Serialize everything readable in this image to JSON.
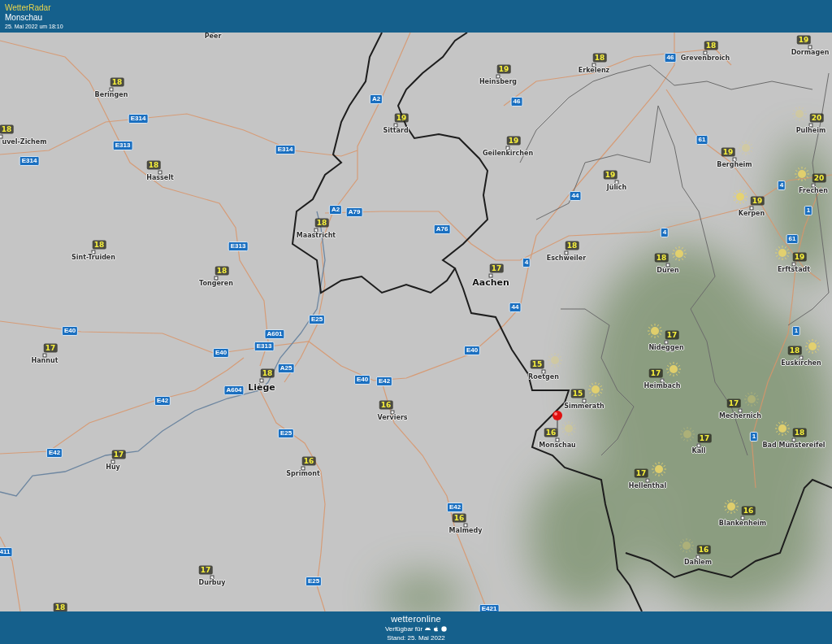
{
  "header": {
    "title": "WetterRadar",
    "location": "Monschau",
    "timestamp": "25. Mai 2022 um 18:10"
  },
  "map": {
    "cities": [
      {
        "name": "Peer"
      },
      {
        "name": "Beringen",
        "temp": "18"
      },
      {
        "name": "uvel-Zichem",
        "temp": "18"
      },
      {
        "name": "Hasselt",
        "temp": "18"
      },
      {
        "name": "Sint-Truiden",
        "temp": "18"
      },
      {
        "name": "Tongeren",
        "temp": "18"
      },
      {
        "name": "Maastricht",
        "temp": "18"
      },
      {
        "name": "Sittard",
        "temp": "19"
      },
      {
        "name": "Heinsberg",
        "temp": "19"
      },
      {
        "name": "Erkelenz",
        "temp": "18"
      },
      {
        "name": "Grevenbroich",
        "temp": "18"
      },
      {
        "name": "Dormagen",
        "temp": "19"
      },
      {
        "name": "Geilenkirchen",
        "temp": "19"
      },
      {
        "name": "Jülich",
        "temp": "19"
      },
      {
        "name": "Pulheim",
        "temp": "20",
        "sun": true,
        "hazy": true
      },
      {
        "name": "Bergheim",
        "temp": "19",
        "sun": true,
        "hazy": true
      },
      {
        "name": "Frechen",
        "temp": "20",
        "sun": true,
        "hazy": false
      },
      {
        "name": "Kerpen",
        "temp": "19",
        "sun": true,
        "hazy": false
      },
      {
        "name": "Eschweiler",
        "temp": "18"
      },
      {
        "name": "Aachen",
        "temp": "17",
        "major": true
      },
      {
        "name": "Düren",
        "temp": "18",
        "sun": true,
        "hazy": false
      },
      {
        "name": "Erftstadt",
        "temp": "19",
        "sun": true,
        "hazy": false
      },
      {
        "name": "Liège",
        "temp": "18",
        "major": true
      },
      {
        "name": "Hannut",
        "temp": "17"
      },
      {
        "name": "Huy",
        "temp": "17"
      },
      {
        "name": "Verviers",
        "temp": "16"
      },
      {
        "name": "Sprimont",
        "temp": "16"
      },
      {
        "name": "Durbuy",
        "temp": "17"
      },
      {
        "temp": "18"
      },
      {
        "name": "Malmedy",
        "temp": "16"
      },
      {
        "name": "Roetgen",
        "temp": "15",
        "sun": true,
        "hazy": true
      },
      {
        "name": "Simmerath",
        "temp": "15",
        "sun": true,
        "hazy": false
      },
      {
        "name": "Monschau",
        "temp": "16",
        "sun": true,
        "hazy": true,
        "pinned": true
      },
      {
        "name": "Nideggen",
        "temp": "17",
        "sun": true,
        "hazy": false
      },
      {
        "name": "Heimbach",
        "temp": "17",
        "sun": true,
        "hazy": false
      },
      {
        "name": "Euskirchen",
        "temp": "18",
        "sun": true,
        "hazy": false
      },
      {
        "name": "Mechernich",
        "temp": "17",
        "sun": true,
        "hazy": true
      },
      {
        "name": "Kall",
        "temp": "17",
        "sun": true,
        "hazy": true
      },
      {
        "name": "Bad Münstereifel",
        "temp": "18",
        "sun": true,
        "hazy": false
      },
      {
        "name": "Hellenthal",
        "temp": "17",
        "sun": true,
        "hazy": false
      },
      {
        "name": "Blankenheim",
        "temp": "16",
        "sun": true,
        "hazy": false
      },
      {
        "name": "Dahlem",
        "temp": "16",
        "sun": true,
        "hazy": true
      }
    ],
    "road_shields": [
      {
        "label": "E314"
      },
      {
        "label": "E313"
      },
      {
        "label": "E314"
      },
      {
        "label": "E314"
      },
      {
        "label": "A2"
      },
      {
        "label": "A2"
      },
      {
        "label": "A79"
      },
      {
        "label": "E25"
      },
      {
        "label": "E313"
      },
      {
        "label": "A76"
      },
      {
        "label": "E40"
      },
      {
        "label": "E40"
      },
      {
        "label": "A601"
      },
      {
        "label": "E313"
      },
      {
        "label": "A25"
      },
      {
        "label": "E42"
      },
      {
        "label": "E42"
      },
      {
        "label": "A604"
      },
      {
        "label": "E40"
      },
      {
        "label": "E42"
      },
      {
        "label": "E25"
      },
      {
        "label": "E25"
      },
      {
        "label": "E40"
      },
      {
        "label": "E42"
      },
      {
        "label": "E421"
      },
      {
        "label": "46"
      },
      {
        "label": "46"
      },
      {
        "label": "61"
      },
      {
        "label": "4"
      },
      {
        "label": "1"
      },
      {
        "label": "61"
      },
      {
        "label": "4"
      },
      {
        "label": "44"
      },
      {
        "label": "4"
      },
      {
        "label": "44"
      },
      {
        "label": "1"
      },
      {
        "label": "1"
      },
      {
        "label": "411"
      }
    ]
  },
  "footer": {
    "logo": "wetteronline",
    "availability": "Verfügbar für",
    "status": "Stand: 25. Mai 2022"
  }
}
